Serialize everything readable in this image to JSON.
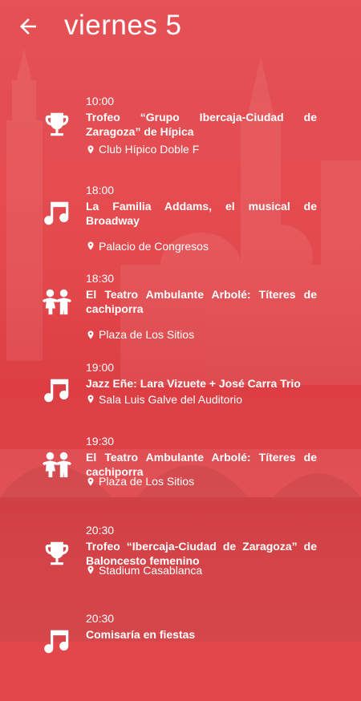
{
  "header": {
    "title": "viernes 5"
  },
  "events": [
    {
      "time": "10:00",
      "name": "Trofeo “Grupo Ibercaja-Ciudad de Zaragoza” de Hípica",
      "place": "Club Hípico Doble F",
      "icon": "trophy-icon"
    },
    {
      "time": "18:00",
      "name": "La Familia Addams, el musical de Broadway",
      "place": "Palacio de Congresos",
      "icon": "music-note-icon"
    },
    {
      "time": "18:30",
      "name": "El Teatro Ambulante Arbolé: Títeres de cachiporra",
      "place": "Plaza de Los Sitios",
      "icon": "children-icon"
    },
    {
      "time": "19:00",
      "name": "Jazz Eñe: Lara Vizuete + José Carra Trio",
      "place": "Sala Luis Galve del Auditorio",
      "icon": "music-note-icon"
    },
    {
      "time": "19:30",
      "name": "El Teatro Ambulante Arbolé: Títeres de cachiporra",
      "place": "Plaza de Los Sitios",
      "icon": "children-icon"
    },
    {
      "time": "20:30",
      "name": "Trofeo “Ibercaja-Ciudad de Zaragoza” de Baloncesto femenino",
      "place": "Stadium Casablanca",
      "icon": "trophy-icon"
    },
    {
      "time": "20:30",
      "name": "Comisaría en fiestas",
      "place": "",
      "icon": "music-note-icon"
    }
  ]
}
